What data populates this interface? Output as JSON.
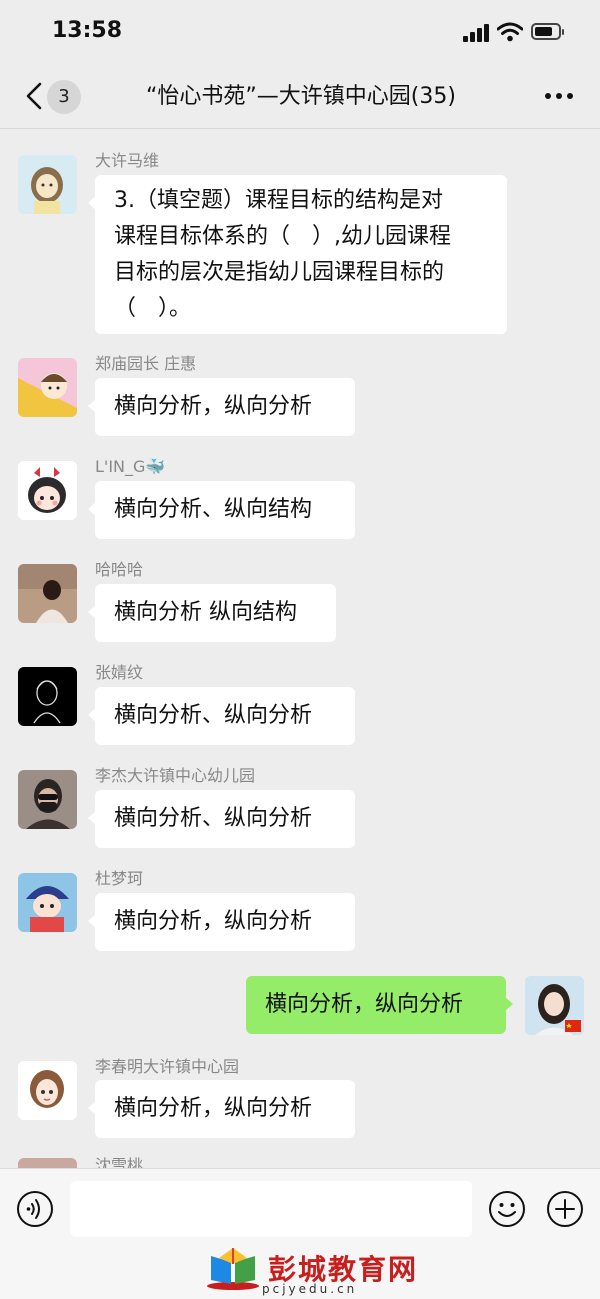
{
  "status_bar": {
    "time": "13:58"
  },
  "header": {
    "back_count": "3",
    "title": "“怡心书苑”—大许镇中心园(35)"
  },
  "messages": [
    {
      "sender": "大许马维",
      "text": "3.（填空题）课程目标的结构是对课程目标体系的（　）,幼儿园课程目标的层次是指幼儿园课程目标的（　）。",
      "lines": [
        "3.（填空题）课程目标的结构是对",
        "课程目标体系的（　）,幼儿园课程",
        "目标的层次是指幼儿园课程目标的",
        "（　）。"
      ]
    },
    {
      "sender": "郑庙园长 庄惠",
      "text": "横向分析，纵向分析"
    },
    {
      "sender": "L'IN_G🐳",
      "text": "横向分析、纵向结构"
    },
    {
      "sender": "哈哈哈",
      "text": "横向分析 纵向结构"
    },
    {
      "sender": "张婧纹",
      "text": "横向分析、纵向分析"
    },
    {
      "sender": "李杰大许镇中心幼儿园",
      "text": "横向分析、纵向分析"
    },
    {
      "sender": "杜梦珂",
      "text": "横向分析，纵向分析"
    },
    {
      "sender": "",
      "self": true,
      "text": "横向分析，纵向分析"
    },
    {
      "sender": "李春明大许镇中心园",
      "text": "横向分析，纵向分析"
    },
    {
      "sender": "沈雪桃",
      "text": ""
    }
  ],
  "watermark": {
    "title": "彭城教育网",
    "url": "pcjyedu.cn"
  },
  "icons": [
    "back-icon",
    "more-icon",
    "voice-icon",
    "emoji-icon",
    "plus-icon"
  ],
  "colors": {
    "background": "#ededed",
    "self_bubble": "#95ec69",
    "other_bubble": "#ffffff",
    "watermark": "#c81e1e"
  }
}
